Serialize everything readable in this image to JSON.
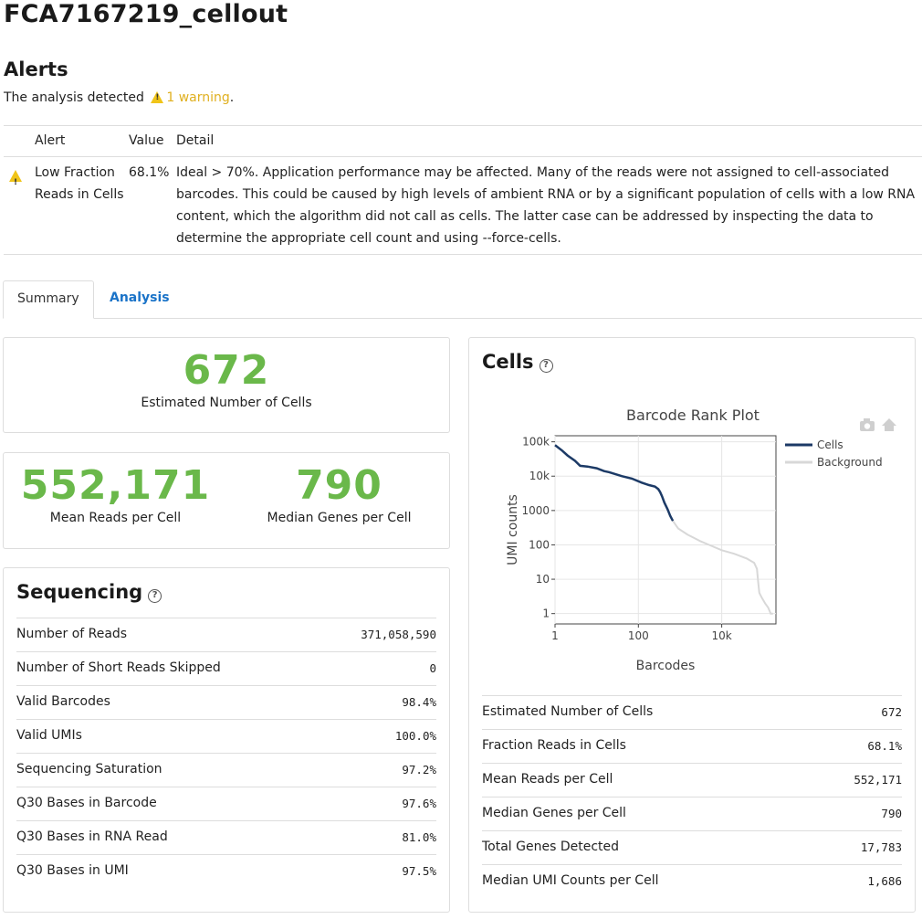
{
  "page": {
    "title": "FCA7167219_cellout"
  },
  "alerts": {
    "heading": "Alerts",
    "summary_prefix": "The analysis detected",
    "summary_warning": "1 warning",
    "summary_suffix": ".",
    "columns": {
      "alert": "Alert",
      "value": "Value",
      "detail": "Detail"
    },
    "items": [
      {
        "icon": "warning-icon",
        "name": "Low Fraction Reads in Cells",
        "value": "68.1%",
        "detail": "Ideal > 70%. Application performance may be affected. Many of the reads were not assigned to cell-associated barcodes. This could be caused by high levels of ambient RNA or by a significant population of cells with a low RNA content, which the algorithm did not call as cells. The latter case can be addressed by inspecting the data to determine the appropriate cell count and using --force-cells."
      }
    ]
  },
  "tabs": [
    {
      "label": "Summary",
      "active": true
    },
    {
      "label": "Analysis",
      "active": false
    }
  ],
  "summary": {
    "estimated_cells": {
      "value": "672",
      "label": "Estimated Number of Cells"
    },
    "mean_reads": {
      "value": "552,171",
      "label": "Mean Reads per Cell"
    },
    "median_genes": {
      "value": "790",
      "label": "Median Genes per Cell"
    },
    "accent_color": "#6ab84a"
  },
  "sequencing": {
    "title": "Sequencing",
    "rows": [
      {
        "label": "Number of Reads",
        "value": "371,058,590"
      },
      {
        "label": "Number of Short Reads Skipped",
        "value": "0"
      },
      {
        "label": "Valid Barcodes",
        "value": "98.4%"
      },
      {
        "label": "Valid UMIs",
        "value": "100.0%"
      },
      {
        "label": "Sequencing Saturation",
        "value": "97.2%"
      },
      {
        "label": "Q30 Bases in Barcode",
        "value": "97.6%"
      },
      {
        "label": "Q30 Bases in RNA Read",
        "value": "81.0%"
      },
      {
        "label": "Q30 Bases in UMI",
        "value": "97.5%"
      }
    ]
  },
  "cells": {
    "title": "Cells",
    "rows": [
      {
        "label": "Estimated Number of Cells",
        "value": "672"
      },
      {
        "label": "Fraction Reads in Cells",
        "value": "68.1%"
      },
      {
        "label": "Mean Reads per Cell",
        "value": "552,171"
      },
      {
        "label": "Median Genes per Cell",
        "value": "790"
      },
      {
        "label": "Total Genes Detected",
        "value": "17,783"
      },
      {
        "label": "Median UMI Counts per Cell",
        "value": "1,686"
      }
    ]
  },
  "chart_data": {
    "type": "line",
    "title": "Barcode Rank Plot",
    "xlabel": "Barcodes",
    "ylabel": "UMI counts",
    "x_scale": "log",
    "y_scale": "log",
    "xlim": [
      1,
      200000
    ],
    "ylim": [
      0.5,
      150000
    ],
    "x_ticks": [
      {
        "v": 1,
        "label": "1"
      },
      {
        "v": 100,
        "label": "100"
      },
      {
        "v": 10000,
        "label": "10k"
      }
    ],
    "y_ticks": [
      {
        "v": 1,
        "label": "1"
      },
      {
        "v": 10,
        "label": "10"
      },
      {
        "v": 100,
        "label": "100"
      },
      {
        "v": 1000,
        "label": "1000"
      },
      {
        "v": 10000,
        "label": "10k"
      },
      {
        "v": 100000,
        "label": "100k"
      }
    ],
    "grid": true,
    "legend_position": "top-right",
    "series": [
      {
        "name": "Cells",
        "color": "#1c3a66",
        "x": [
          1,
          1.5,
          2,
          3,
          4,
          6,
          10,
          15,
          20,
          40,
          70,
          120,
          180,
          250,
          300,
          330,
          370,
          420,
          500,
          580,
          672
        ],
        "y": [
          80000,
          55000,
          40000,
          28000,
          20000,
          19000,
          17000,
          14000,
          13000,
          10000,
          8500,
          6500,
          5500,
          5000,
          4200,
          3500,
          2600,
          1700,
          1100,
          700,
          500
        ]
      },
      {
        "name": "Background",
        "color": "#d8d8d8",
        "x": [
          672,
          900,
          1500,
          3000,
          5000,
          10000,
          20000,
          40000,
          60000,
          70000,
          75000,
          80000,
          90000,
          110000,
          130000,
          150000,
          170000
        ],
        "y": [
          500,
          300,
          200,
          130,
          100,
          70,
          55,
          40,
          30,
          20,
          8,
          4,
          3,
          2,
          1.5,
          1,
          1
        ]
      }
    ]
  }
}
